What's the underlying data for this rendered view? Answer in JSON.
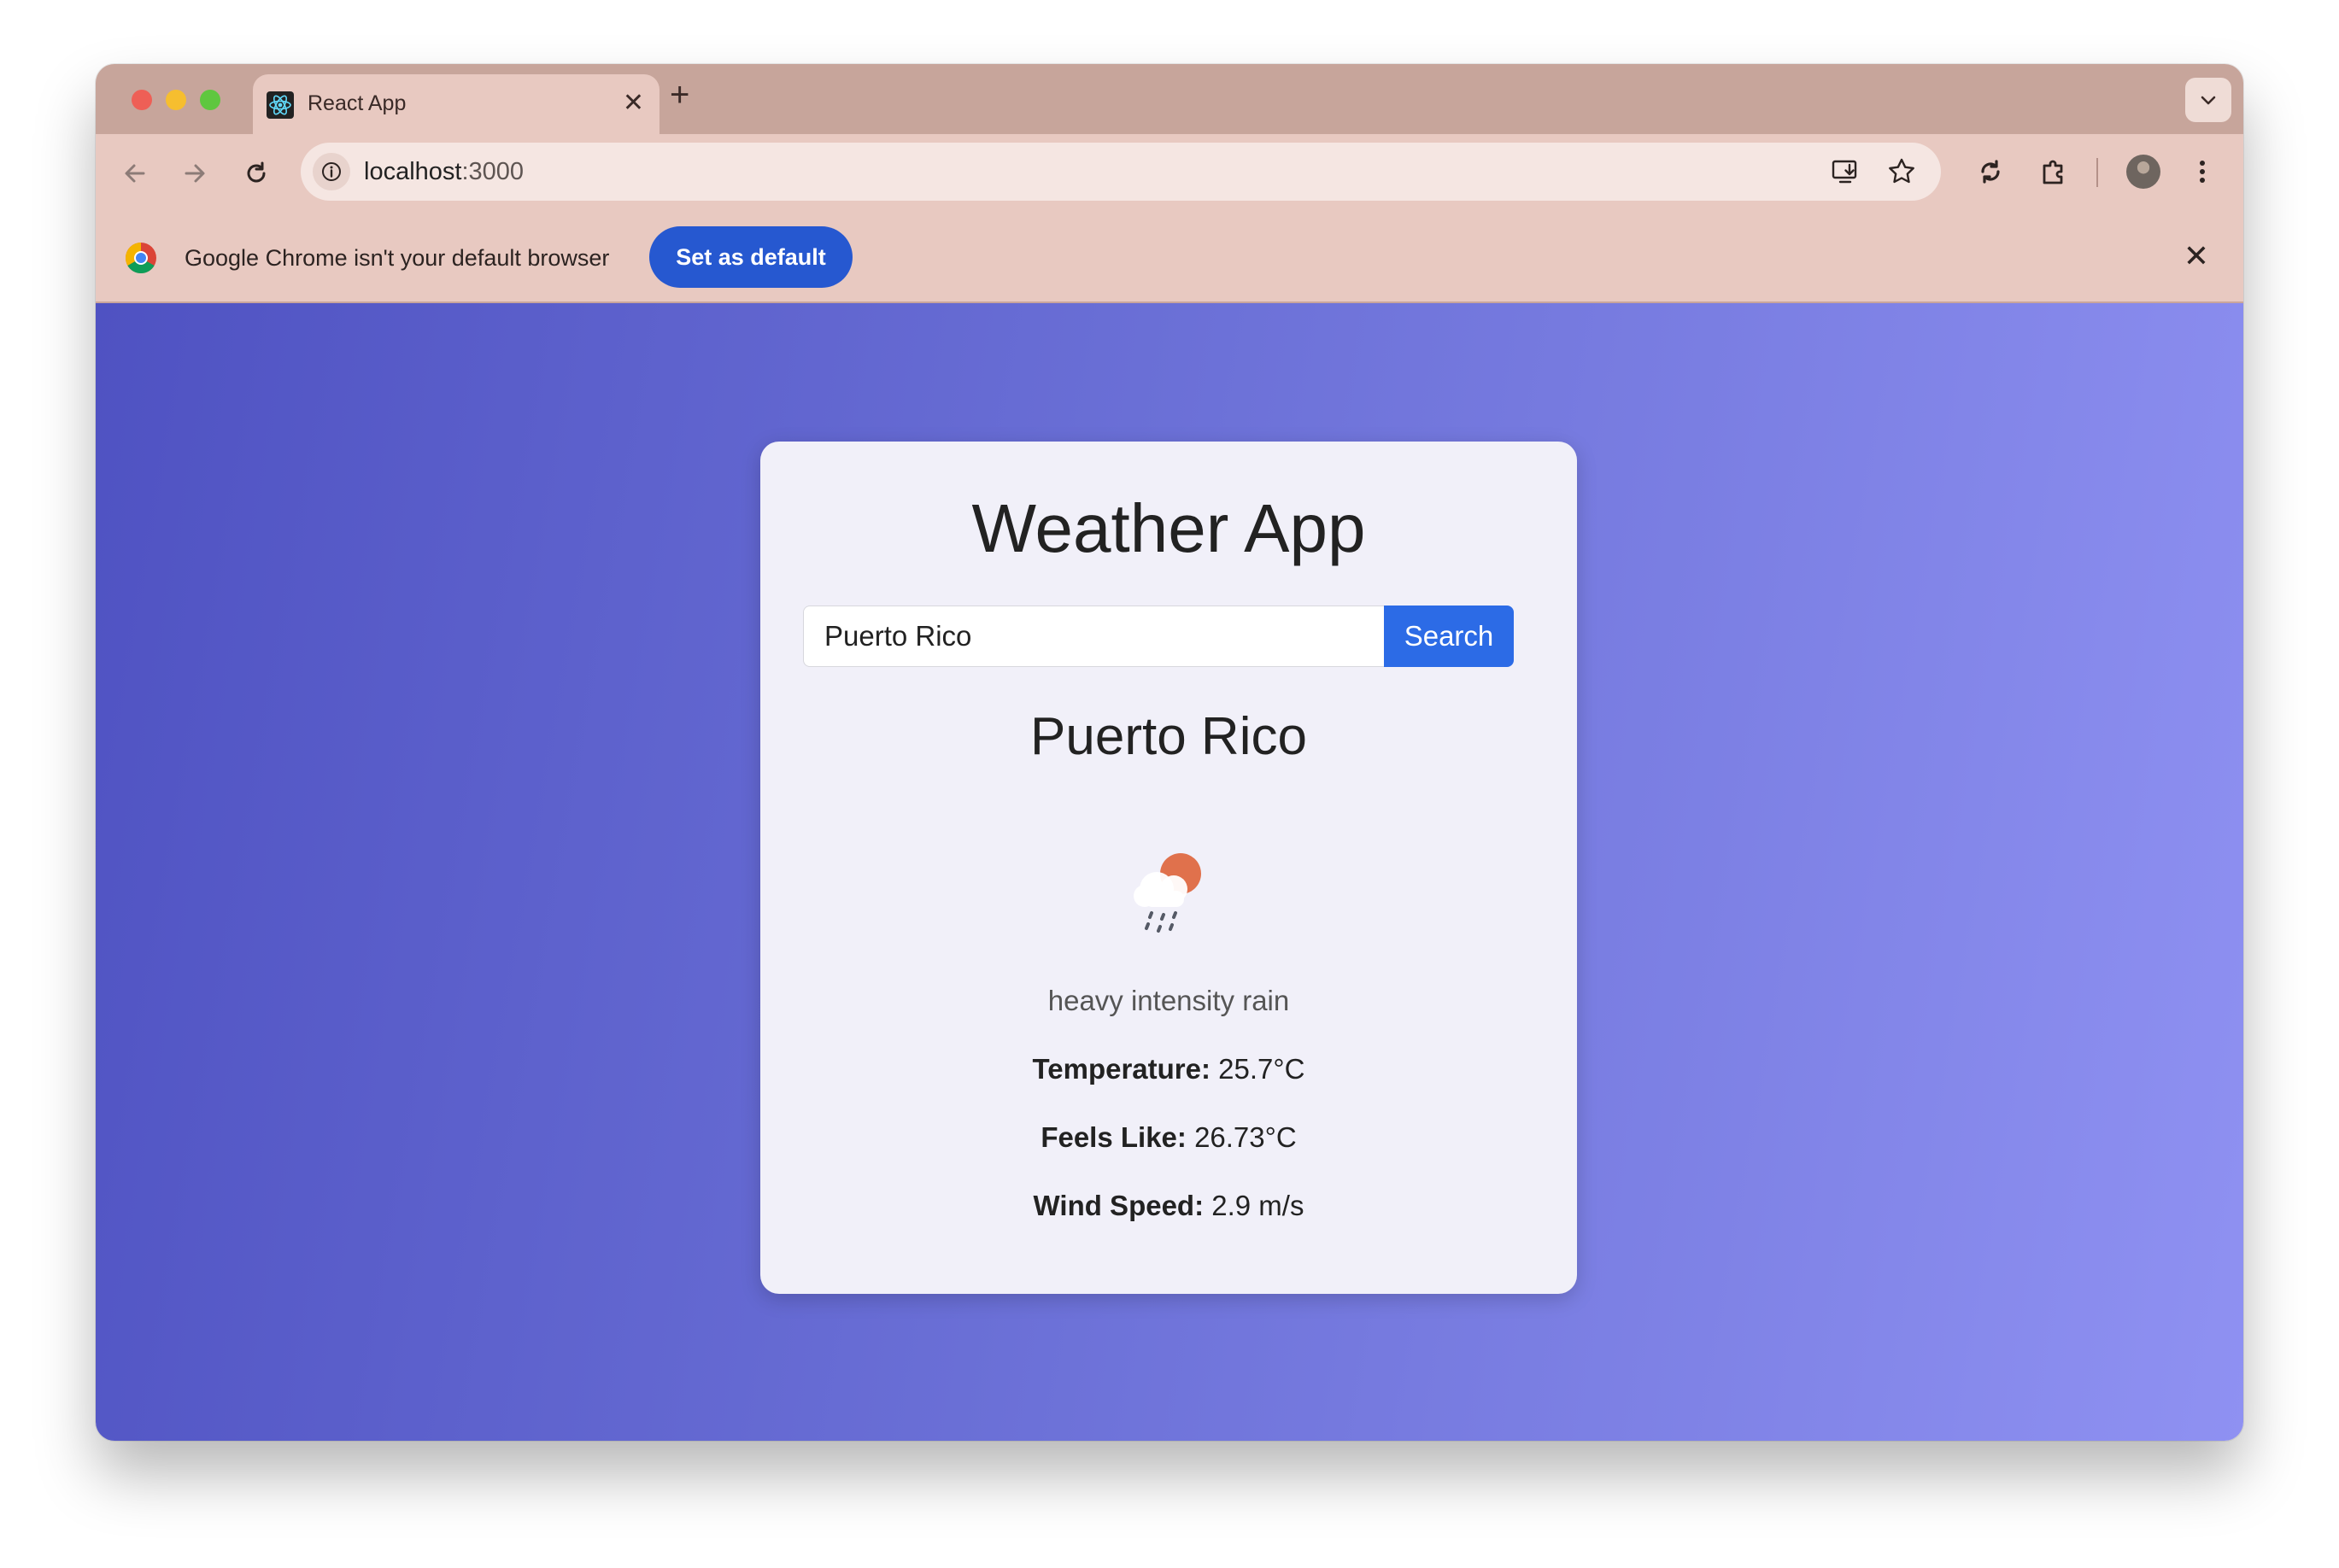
{
  "browser": {
    "tab": {
      "title": "React App"
    },
    "address": {
      "host": "localhost",
      "port": ":3000"
    },
    "infobar": {
      "message": "Google Chrome isn't your default browser",
      "button_label": "Set as default"
    }
  },
  "app": {
    "title": "Weather App",
    "search": {
      "value": "Puerto Rico",
      "button_label": "Search"
    },
    "city": "Puerto Rico",
    "icon": "rain-cloud-sun-icon",
    "description": "heavy intensity rain",
    "stats": [
      {
        "label": "Temperature:",
        "value": "25.7°C"
      },
      {
        "label": "Feels Like:",
        "value": "26.73°C"
      },
      {
        "label": "Wind Speed:",
        "value": "2.9 m/s"
      }
    ]
  },
  "colors": {
    "accent": "#2c6be6",
    "chrome_button": "#2658d0",
    "gradient_start": "#4f52c2",
    "gradient_end": "#8f91f2"
  }
}
